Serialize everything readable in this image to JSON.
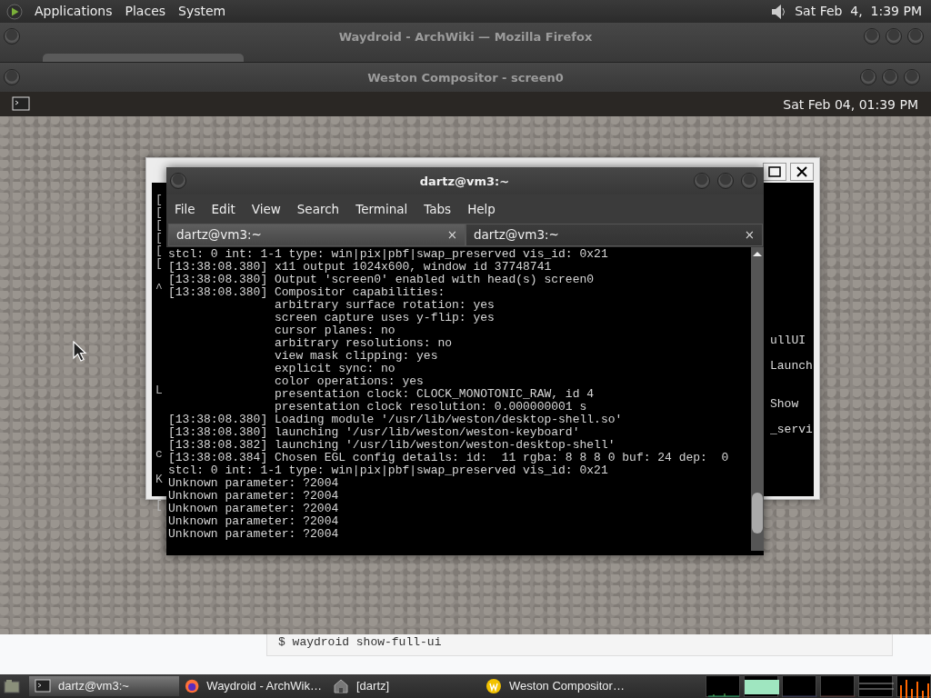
{
  "top_panel": {
    "menus": [
      "Applications",
      "Places",
      "System"
    ],
    "clock": "Sat Feb  4,  1:39 PM"
  },
  "firefox_window": {
    "title": "Waydroid - ArchWiki — Mozilla Firefox",
    "code_line": "$ waydroid show-full-ui"
  },
  "weston_window": {
    "title": "Weston Compositor - screen0",
    "panel_clock": "Sat Feb 04, 01:39 PM"
  },
  "back_terminal": {
    "left_fragments": [
      "[",
      "[",
      "[",
      "[",
      "[",
      "[",
      "^",
      "L",
      "c",
      "K",
      "["
    ],
    "right_fragments": [
      "ullUI",
      "Launch",
      "Show",
      "_servi"
    ]
  },
  "terminal_window": {
    "title": "dartz@vm3:~",
    "menus": [
      "File",
      "Edit",
      "View",
      "Search",
      "Terminal",
      "Tabs",
      "Help"
    ],
    "tabs": [
      {
        "label": "dartz@vm3:~",
        "close": "×",
        "selected": false
      },
      {
        "label": "dartz@vm3:~",
        "close": "×",
        "selected": true
      }
    ],
    "lines": [
      "stcl: 0 int: 1-1 type: win|pix|pbf|swap_preserved vis_id: 0x21",
      "[13:38:08.380] x11 output 1024x600, window id 37748741",
      "[13:38:08.380] Output 'screen0' enabled with head(s) screen0",
      "[13:38:08.380] Compositor capabilities:",
      "               arbitrary surface rotation: yes",
      "               screen capture uses y-flip: yes",
      "               cursor planes: no",
      "               arbitrary resolutions: no",
      "               view mask clipping: yes",
      "               explicit sync: no",
      "               color operations: yes",
      "               presentation clock: CLOCK_MONOTONIC_RAW, id 4",
      "               presentation clock resolution: 0.000000001 s",
      "[13:38:08.380] Loading module '/usr/lib/weston/desktop-shell.so'",
      "[13:38:08.380] launching '/usr/lib/weston/weston-keyboard'",
      "[13:38:08.382] launching '/usr/lib/weston/weston-desktop-shell'",
      "[13:38:08.384] Chosen EGL config details: id:  11 rgba: 8 8 8 0 buf: 24 dep:  0",
      "stcl: 0 int: 1-1 type: win|pix|pbf|swap_preserved vis_id: 0x21",
      "Unknown parameter: ?2004",
      "Unknown parameter: ?2004",
      "Unknown parameter: ?2004",
      "Unknown parameter: ?2004",
      "Unknown parameter: ?2004"
    ]
  },
  "taskbar": {
    "tasks": [
      {
        "label": "dartz@vm3:~",
        "kind": "terminal",
        "selected": true
      },
      {
        "label": "Waydroid - ArchWik…",
        "kind": "browser",
        "selected": false
      },
      {
        "label": "[dartz]",
        "kind": "folder",
        "selected": false
      },
      {
        "label": "Weston Compositor…",
        "kind": "weston",
        "selected": false
      }
    ]
  }
}
